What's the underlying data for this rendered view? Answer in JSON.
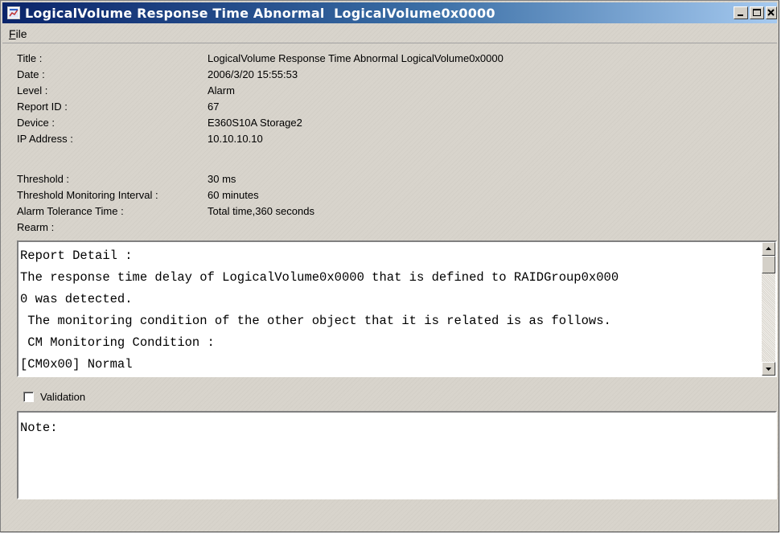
{
  "window": {
    "title": "LogicalVolume Response Time Abnormal  LogicalVolume0x0000",
    "controls": {
      "minimize": "minimize",
      "maximize": "maximize",
      "close": "close"
    }
  },
  "menu": {
    "file_hotkey": "F",
    "file_rest": "ile"
  },
  "fields": [
    {
      "label": "Title :",
      "value": "LogicalVolume Response Time Abnormal  LogicalVolume0x0000"
    },
    {
      "label": "Date :",
      "value": "2006/3/20  15:55:53"
    },
    {
      "label": "Level :",
      "value": "Alarm"
    },
    {
      "label": "Report ID :",
      "value": "67"
    },
    {
      "label": "Device :",
      "value": "E360S10A  Storage2"
    },
    {
      "label": "IP Address :",
      "value": "10.10.10.10"
    }
  ],
  "thresholds": [
    {
      "label": "Threshold :",
      "value": "30 ms"
    },
    {
      "label": "Threshold Monitoring Interval :",
      "value": "60 minutes"
    },
    {
      "label": "Alarm Tolerance Time :",
      "value": "Total time,360 seconds"
    },
    {
      "label": "Rearm :",
      "value": ""
    }
  ],
  "detail": {
    "lines": [
      "Report Detail :",
      "The response time delay of LogicalVolume0x0000 that is defined to RAIDGroup0x000",
      "0 was detected.",
      " The monitoring condition of the other object that it is related is as follows.",
      " CM Monitoring Condition :",
      "[CM0x00] Normal"
    ]
  },
  "validation": {
    "label": "Validation",
    "checked": false
  },
  "note": {
    "text": "Note:"
  },
  "colors": {
    "titlebar_start": "#0a246a",
    "titlebar_end": "#a6caf0",
    "window_bg": "#d8d4cc"
  }
}
